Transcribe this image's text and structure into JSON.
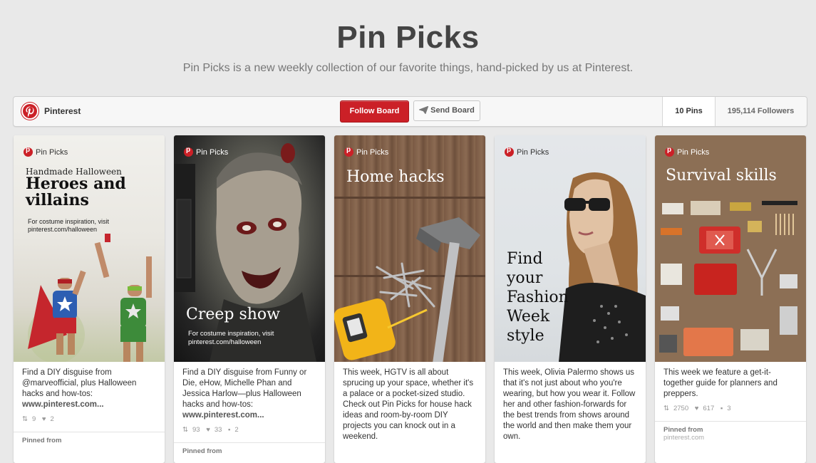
{
  "header": {
    "title": "Pin Picks",
    "subtitle": "Pin Picks is a new weekly collection of our favorite things, hand-picked by us at Pinterest."
  },
  "board": {
    "owner": "Pinterest",
    "follow_label": "Follow Board",
    "send_label": "Send Board",
    "pins_tab": "10 Pins",
    "followers_tab": "195,114 Followers",
    "brand_color": "#cb2027"
  },
  "pins": [
    {
      "badge": "Pin Picks",
      "overlay_kicker": "Handmade Halloween",
      "overlay_title": "Heroes and villains",
      "overlay_note": "For costume inspiration, visit pinterest.com/halloween",
      "description": "Find a DIY disguise from @marveofficial, plus Halloween hacks and how-tos:",
      "link": "www.pinterest.com...",
      "repins": "9",
      "likes": "2",
      "comments": "",
      "pinned_from": "Pinned from",
      "source": ""
    },
    {
      "badge": "Pin Picks",
      "overlay_title": "Creep show",
      "overlay_note": "For costume inspiration, visit pinterest.com/halloween",
      "description": "Find a DIY disguise from Funny or Die, eHow, Michelle Phan and Jessica Harlow—plus Halloween hacks and how-tos:",
      "link": "www.pinterest.com...",
      "repins": "93",
      "likes": "33",
      "comments": "2",
      "pinned_from": "Pinned from",
      "source": ""
    },
    {
      "badge": "Pin Picks",
      "overlay_title": "Home hacks",
      "description": "This week, HGTV is all about sprucing up your space, whether it's a palace or a pocket-sized studio. Check out Pin Picks for house hack ideas and room-by-room DIY projects you can knock out in a weekend.",
      "repins": "",
      "likes": "",
      "comments": ""
    },
    {
      "badge": "Pin Picks",
      "overlay_title": "Find your Fashion Week style",
      "description": "This week, Olivia Palermo shows us that it's not just about who you're wearing, but how you wear it. Follow her and other fashion-forwards for the best trends from shows around the world and then make them your own.",
      "repins": "",
      "likes": "",
      "comments": ""
    },
    {
      "badge": "Pin Picks",
      "overlay_title": "Survival skills",
      "description": "This week we feature a get-it-together guide for planners and preppers.",
      "repins": "2750",
      "likes": "617",
      "comments": "3",
      "pinned_from": "Pinned from",
      "source": "pinterest.com"
    }
  ]
}
